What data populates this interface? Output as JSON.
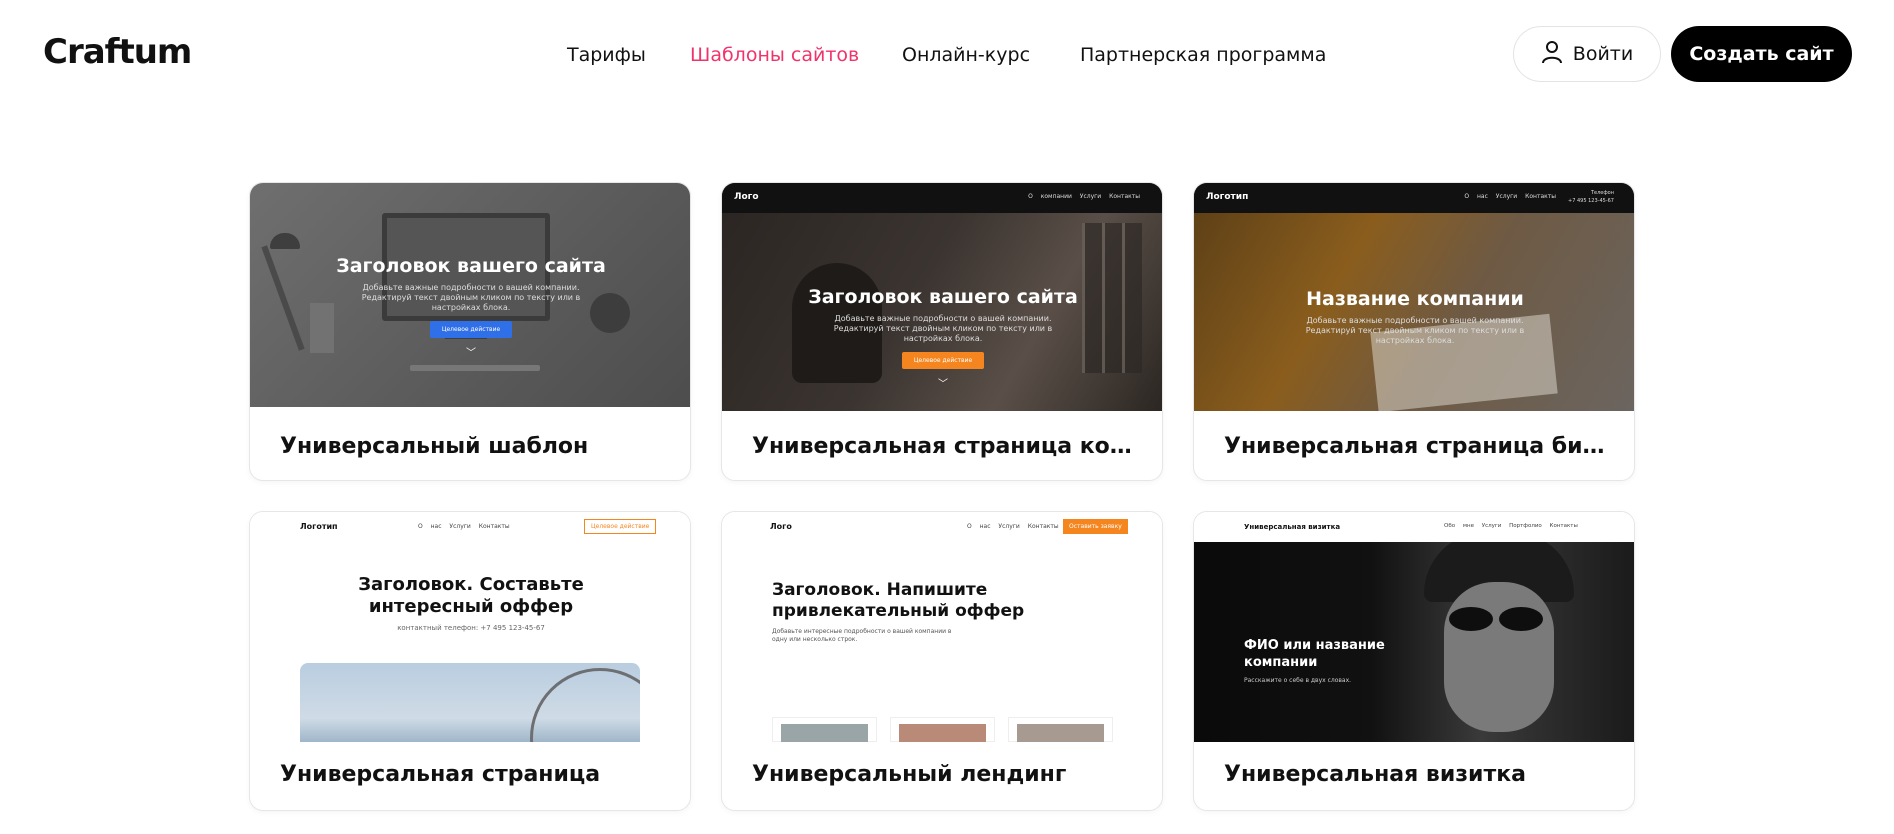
{
  "header": {
    "logo": "Craftum",
    "nav": [
      "Тарифы",
      "Шаблоны сайтов",
      "Онлайн-курс",
      "Партнерская программа"
    ],
    "active_nav": "Шаблоны сайтов",
    "login_label": "Войти",
    "create_label": "Создать сайт"
  },
  "colors": {
    "accent": "#f0336b",
    "primary_dark": "#000000",
    "orange": "#f5861f",
    "blue": "#2f6fe8"
  },
  "cards": [
    {
      "title": "Универсальный шаблон",
      "preview": {
        "hero_title": "Заголовок вашего сайта",
        "hero_sub": "Добавьте важные подробности о вашей компании. Редактируй текст двойным кликом по тексту или в настройках блока.",
        "cta": "Целевое действие"
      }
    },
    {
      "title": "Универсальная страница компан…",
      "preview": {
        "logo": "Лого",
        "links": "О компании Услуги Контакты",
        "hero_title": "Заголовок вашего сайта",
        "hero_sub": "Добавьте важные подробности о вашей компании. Редактируй текст двойным кликом по тексту или в настройках блока.",
        "cta": "Целевое действие"
      }
    },
    {
      "title": "Универсальная страница бизнеса",
      "preview": {
        "logo": "Логотип",
        "links": "О нас Услуги Контакты",
        "phone_label": "Телефон",
        "phone": "+7 495 123-45-67",
        "hero_title": "Название компании",
        "hero_sub": "Добавьте важные подробности о вашей компании. Редактируй текст двойным кликом по тексту или в настройках блока."
      }
    },
    {
      "title": "Универсальная страница",
      "preview": {
        "logo": "Логотип",
        "links": "О нас Услуги Контакты",
        "cta": "Целевое действие",
        "hero_title": "Заголовок. Составьте интересный оффер",
        "hero_sub": "контактный телефон: +7 495 123-45-67"
      }
    },
    {
      "title": "Универсальный лендинг",
      "preview": {
        "logo": "Лого",
        "links": "О нас Услуги Контакты",
        "cta": "Оставить заявку",
        "hero_title": "Заголовок. Напишите привлекательный оффер",
        "hero_sub": "Добавьте интересные подробности о вашей компании в одну или несколько строк."
      }
    },
    {
      "title": "Универсальная визитка",
      "preview": {
        "logo": "Универсальная визитка",
        "links": "Обо мне Услуги Портфолио Контакты",
        "hero_title": "ФИО или название компании",
        "hero_sub": "Расскажите о себе в двух словах."
      }
    }
  ]
}
